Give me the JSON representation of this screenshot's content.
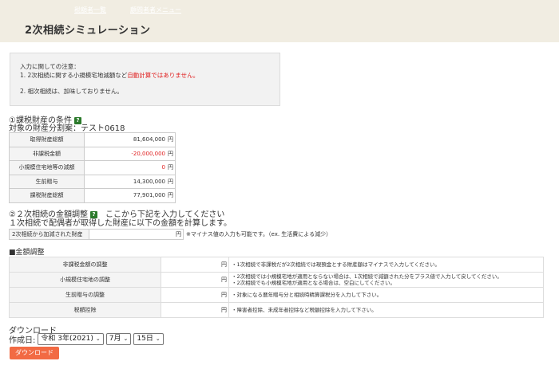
{
  "nav": {
    "links": [
      "税額者一覧",
      "顧問者者メニュー"
    ]
  },
  "page_title": "2次相続シミュレーション",
  "notice": {
    "heading": "入力に関しての注意：",
    "line1_prefix": "1. 2次相続に関する小規模宅地減額など",
    "line1_red": "自動計算ではありません。",
    "line2": "2. 相次相続は、加味しておりません。"
  },
  "conditions": {
    "title": "①課税財産の条件",
    "subtitle": "対象の財産分割案：テスト0618",
    "rows": [
      {
        "label": "取得財産総額",
        "value": "81,604,000",
        "unit": "円",
        "red": false
      },
      {
        "label": "非課税金額",
        "value": "-20,000,000",
        "unit": "円",
        "red": true
      },
      {
        "label": "小規模住宅地等の減額",
        "value": "0",
        "unit": "円",
        "red": true
      },
      {
        "label": "生前贈与",
        "value": "14,300,000",
        "unit": "円",
        "red": false
      },
      {
        "label": "課税財産総額",
        "value": "77,901,000",
        "unit": "円",
        "red": false
      }
    ]
  },
  "second": {
    "title": "②２次相続の金額調整",
    "title_suffix": "ここから下記を入力してください",
    "subtitle": "１次相続で配偶者が取得した財産に以下の金額を計算します。",
    "added": {
      "label": "2次相続から加減された財産",
      "unit": "円",
      "note": "※マイナス値の入力も可能です。（ex. 生活費による減少）"
    }
  },
  "adjust": {
    "title": "■金額調整",
    "rows": [
      {
        "label": "非課税金額の調整",
        "unit": "円",
        "notes": [
          "・1次相続で非課税だが2次相続では現預金とする財産額はマイナスで入力してください。"
        ]
      },
      {
        "label": "小規模住宅地の調整",
        "unit": "円",
        "notes": [
          "・2次相続では小規模宅地が適用とならない場合は、1次相続で減額された分をプラス値で入力して戻してください。",
          "・2次相続でも小規模宅地が適用となる場合は、空白にしてください。"
        ]
      },
      {
        "label": "生前贈与の調整",
        "unit": "円",
        "notes": [
          "・対象になる暦年贈与分と相続時精算課税分を入力して下さい。"
        ]
      },
      {
        "label": "税額控除",
        "unit": "円",
        "notes": [
          "・障害者控除、未成年者控除など税額控除を入力して下さい。"
        ]
      }
    ]
  },
  "download": {
    "title": "ダウンロード",
    "date_label": "作成日:",
    "year": "令和 3年(2021)",
    "month": "7月",
    "day": "15日",
    "button": "ダウンロード"
  },
  "colors": {
    "header_bg": "#f1ede2",
    "accent_red": "#e02020",
    "button": "#f26a43",
    "help_icon": "#2b7a2b"
  }
}
